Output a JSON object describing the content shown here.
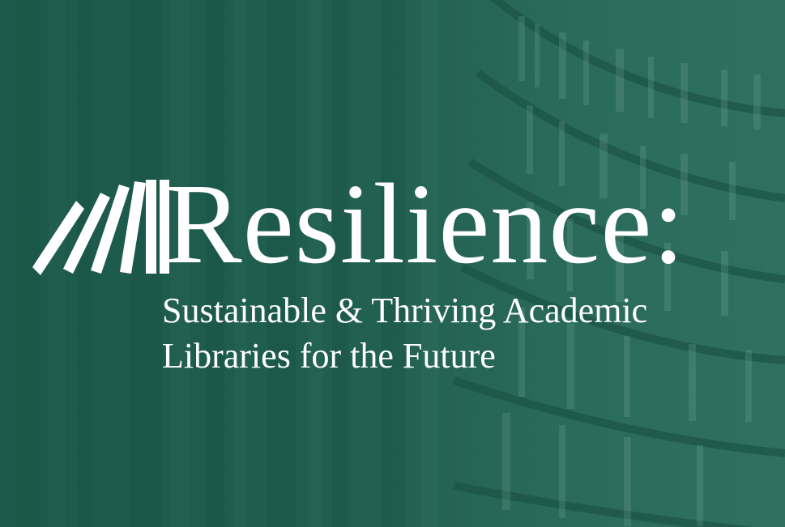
{
  "colors": {
    "background": "#1f5e4f",
    "text": "#ffffff"
  },
  "banner": {
    "title": "Resilience:",
    "subtitle_line1": "Sustainable & Thriving Academic",
    "subtitle_line2": "Libraries for the Future",
    "logo_icon": "leaning-books-icon"
  }
}
